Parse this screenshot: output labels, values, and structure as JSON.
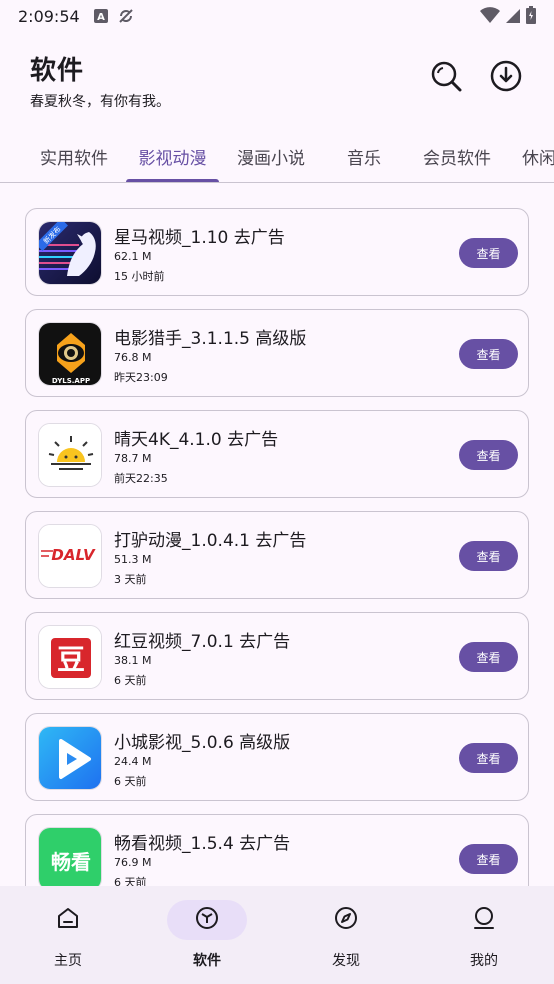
{
  "status_bar": {
    "time": "2:09:54"
  },
  "header": {
    "title": "软件",
    "subtitle": "春夏秋冬，有你有我。"
  },
  "tabs": [
    {
      "label": "实用软件"
    },
    {
      "label": "影视动漫",
      "active": true
    },
    {
      "label": "漫画小说"
    },
    {
      "label": "音乐"
    },
    {
      "label": "会员软件"
    },
    {
      "label": "休闲"
    }
  ],
  "apps": [
    {
      "name": "星马视频_1.10 去广告",
      "size": "62.1 M",
      "time": "15 小时前",
      "icon": "starhorse-icon",
      "icon_text": "新发布",
      "button": "查看"
    },
    {
      "name": "电影猎手_3.1.1.5 高级版",
      "size": "76.8 M",
      "time": "昨天23:09",
      "icon": "movie-hunter-icon",
      "icon_text": "DYLS.APP",
      "button": "查看"
    },
    {
      "name": "晴天4K_4.1.0 去广告",
      "size": "78.7 M",
      "time": "前天22:35",
      "icon": "sunny-icon",
      "button": "查看"
    },
    {
      "name": "打驴动漫_1.0.4.1 去广告",
      "size": "51.3 M",
      "time": "3 天前",
      "icon": "dalv-icon",
      "icon_text": "DALV",
      "button": "查看"
    },
    {
      "name": "红豆视频_7.0.1 去广告",
      "size": "38.1 M",
      "time": "6 天前",
      "icon": "hongdou-icon",
      "icon_text": "豆",
      "button": "查看"
    },
    {
      "name": "小城影视_5.0.6 高级版",
      "size": "24.4 M",
      "time": "6 天前",
      "icon": "play-icon",
      "button": "查看"
    },
    {
      "name": "畅看视频_1.5.4 去广告",
      "size": "76.9 M",
      "time": "6 天前",
      "icon": "changkan-icon",
      "icon_text": "畅看",
      "button": "查看"
    }
  ],
  "bottom_nav": [
    {
      "label": "主页",
      "icon": "home-icon"
    },
    {
      "label": "软件",
      "icon": "cube-icon",
      "active": true
    },
    {
      "label": "发现",
      "icon": "compass-icon"
    },
    {
      "label": "我的",
      "icon": "person-icon"
    }
  ],
  "colors": {
    "accent": "#6750a4",
    "background": "#fdf7fe",
    "nav_bg": "#f3edf7",
    "active_pill": "#e8def8"
  }
}
